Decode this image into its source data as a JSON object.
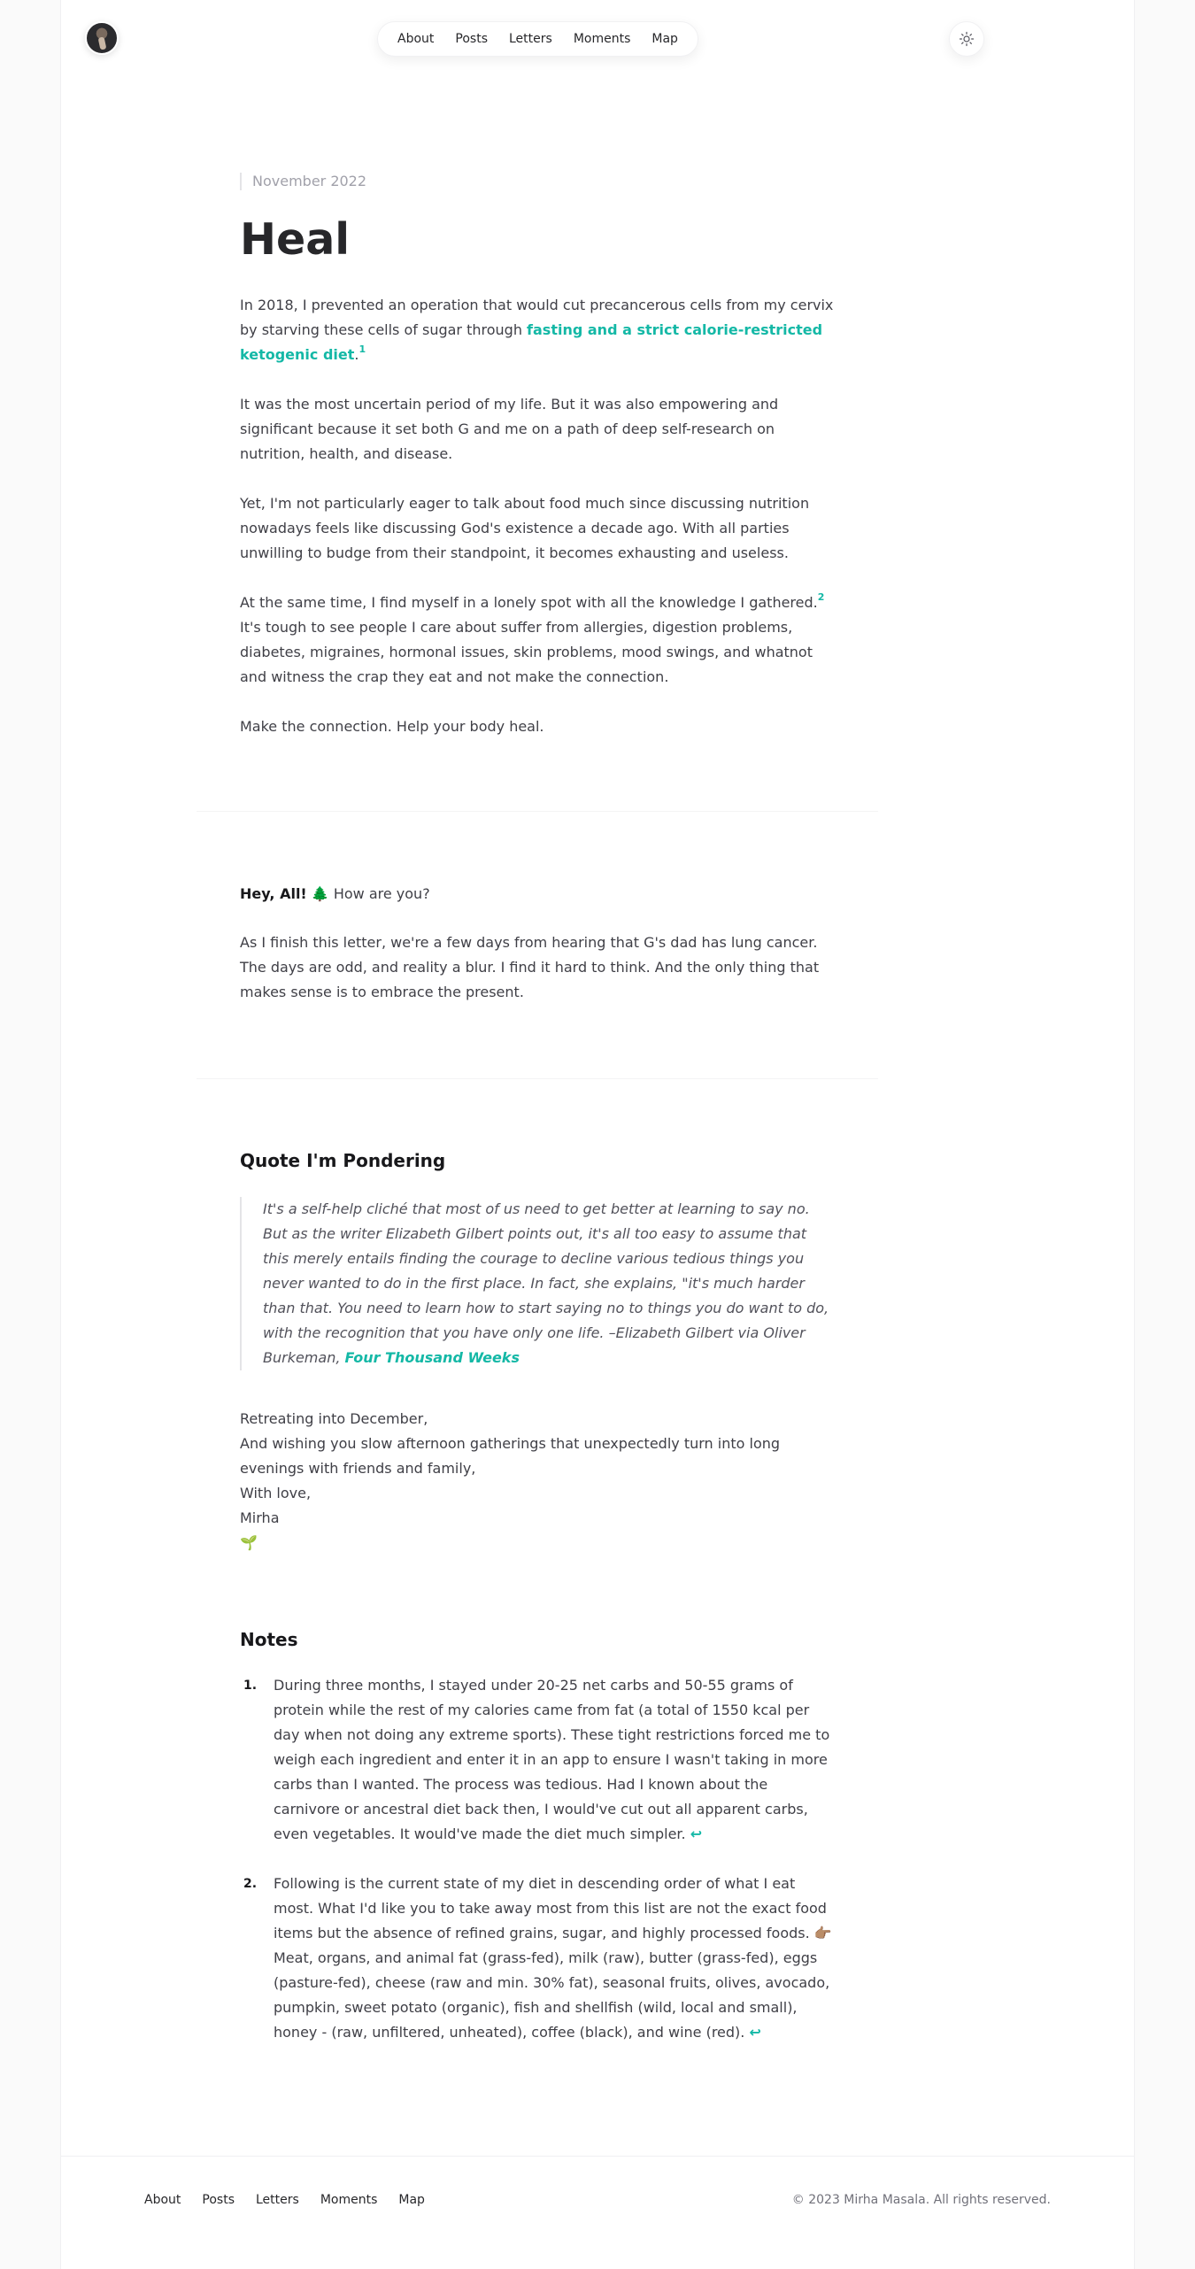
{
  "nav": {
    "items": [
      "About",
      "Posts",
      "Letters",
      "Moments",
      "Map"
    ]
  },
  "post": {
    "date": "November 2022",
    "title": "Heal",
    "p1_before": "In 2018, I prevented an operation that would cut precancerous cells from my cervix by starving these cells of sugar through ",
    "p1_link": "fasting and a strict calorie-restricted ketogenic diet",
    "p1_after": ".",
    "p1_sup": "1",
    "p2": "It was the most uncertain period of my life. But it was also empowering and significant because it set both G and me on a path of deep self-research on nutrition, health, and disease.",
    "p3": "Yet, I'm not particularly eager to talk about food much since discussing nutrition nowadays feels like discussing God's existence a decade ago. With all parties unwilling to budge from their standpoint, it becomes exhausting and useless.",
    "p4_before": "At the same time, I find myself in a lonely spot with all the knowledge I gathered.",
    "p4_sup": "2",
    "p4_after": " It's tough to see people I care about suffer from allergies, digestion problems, diabetes, migraines, hormonal issues, skin problems, mood swings, and whatnot and witness the crap they eat and not make the connection.",
    "p5": "Make the connection. Help your body heal."
  },
  "letter": {
    "greeting_bold": "Hey, All!",
    "greeting_emoji": "🌲",
    "greeting_rest": " How are you?",
    "body": "As I finish this letter, we're a few days from hearing that G's dad has lung cancer. The days are odd, and reality a blur. I find it hard to think. And the only thing that makes sense is to embrace the present."
  },
  "quote": {
    "heading": "Quote I'm Pondering",
    "text": "It's a self-help cliché that most of us need to get better at learning to say no. But as the writer Elizabeth Gilbert points out, it's all too easy to assume that this merely entails finding the courage to decline various tedious things you never wanted to do in the first place. In fact, she explains, \"it's much harder than that. You need to learn how to start saying no to things you do want to do, with the recognition that you have only one life. –Elizabeth Gilbert via Oliver Burkeman, ",
    "source_link": "Four Thousand Weeks"
  },
  "signoff": {
    "line1": "Retreating into December,",
    "line2": "And wishing you slow afternoon gatherings that unexpectedly turn into long evenings with friends and family,",
    "line3": "With love,",
    "line4": "Mirha",
    "emoji": "🌱"
  },
  "notes": {
    "heading": "Notes",
    "items": [
      {
        "num": "1.",
        "text": "During three months, I stayed under 20-25 net carbs and 50-55 grams of protein while the rest of my calories came from fat (a total of 1550 kcal per day when not doing any extreme sports). These tight restrictions forced me to weigh each ingredient and enter it in an app to ensure I wasn't taking in more carbs than I wanted. The process was tedious. Had I known about the carnivore or ancestral diet back then, I would've cut out all apparent carbs, even vegetables. It would've made the diet much simpler. ",
        "back": "↩"
      },
      {
        "num": "2.",
        "text": "Following is the current state of my diet in descending order of what I eat most. What I'd like you to take away most from this list are not the exact food items but the absence of refined grains, sugar, and highly processed foods.",
        "emoji": "👉🏽",
        "text2": " Meat, organs, and animal fat (grass-fed), milk (raw), butter (grass-fed), eggs (pasture-fed), cheese (raw and min. 30% fat), seasonal fruits, olives, avocado, pumpkin, sweet potato (organic), fish and shellfish (wild, local and small), honey - (raw, unfiltered, unheated), coffee (black), and wine (red). ",
        "back": "↩"
      }
    ]
  },
  "footer": {
    "links": [
      "About",
      "Posts",
      "Letters",
      "Moments",
      "Map"
    ],
    "copyright": "© 2023 Mirha Masala. All rights reserved."
  },
  "colors": {
    "accent": "#14b8a6",
    "text": "#3f3f46",
    "heading": "#27272a",
    "muted": "#a1a1aa"
  },
  "icons": {
    "theme_toggle": "sun-icon"
  }
}
